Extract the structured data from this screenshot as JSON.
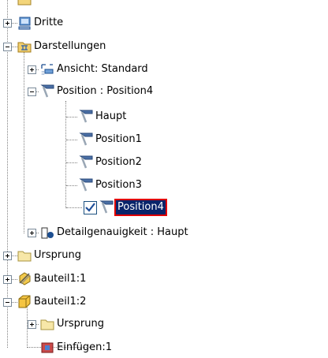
{
  "tree": {
    "top_partial": "Dritte",
    "items": [
      {
        "label": "Dritte",
        "icon": "sketch-monitor-icon"
      },
      {
        "label": "Darstellungen",
        "icon": "representations-folder-icon"
      },
      {
        "label": "Ansicht: Standard",
        "icon": "view-icon"
      },
      {
        "label": "Position : Position4",
        "icon": "position-icon"
      },
      {
        "label": "Haupt",
        "icon": "position-icon"
      },
      {
        "label": "Position1",
        "icon": "position-icon"
      },
      {
        "label": "Position2",
        "icon": "position-icon"
      },
      {
        "label": "Position3",
        "icon": "position-icon"
      },
      {
        "label": "Position4",
        "icon": "position-icon",
        "checked": true,
        "selected": true
      },
      {
        "label": "Detailgenauigkeit : Haupt",
        "icon": "level-of-detail-icon"
      },
      {
        "label": "Ursprung",
        "icon": "folder-icon"
      },
      {
        "label": "Bauteil1:1",
        "icon": "part-grounded-icon"
      },
      {
        "label": "Bauteil1:2",
        "icon": "part-icon"
      },
      {
        "label": "Ursprung",
        "icon": "folder-icon"
      },
      {
        "label": "Einfügen:1",
        "icon": "insert-constraint-icon"
      }
    ]
  },
  "colors": {
    "selection": "#0a246a",
    "selection_outline": "#e00000",
    "position_flag": "#4a6fa5",
    "folder": "#f5e6a6"
  }
}
